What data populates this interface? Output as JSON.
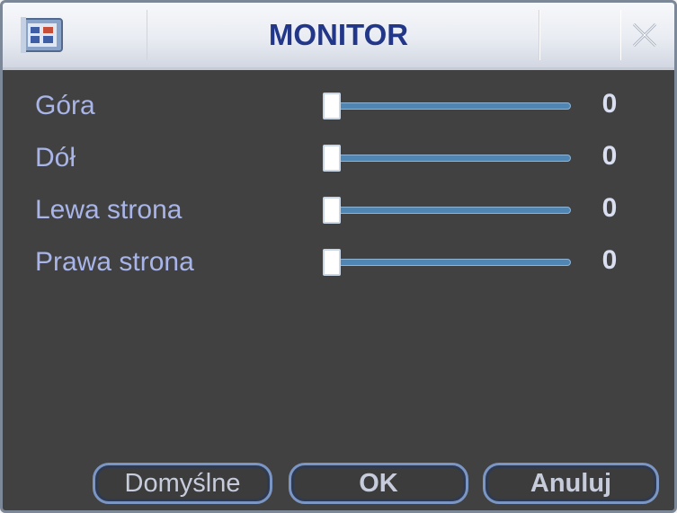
{
  "window": {
    "title": "MONITOR"
  },
  "settings": [
    {
      "label": "Góra",
      "value": "0",
      "fraction": 0
    },
    {
      "label": "Dół",
      "value": "0",
      "fraction": 0
    },
    {
      "label": "Lewa strona",
      "value": "0",
      "fraction": 0
    },
    {
      "label": "Prawa strona",
      "value": "0",
      "fraction": 0
    }
  ],
  "buttons": {
    "default_label": "Domyślne",
    "ok_label": "OK",
    "cancel_label": "Anuluj"
  },
  "colors": {
    "dialog_background": "#414141",
    "title_text": "#223788",
    "label_text": "#a9b5e8",
    "slider_track": "#4f86b4"
  },
  "icons": {
    "app": "monitor-app-icon",
    "close": "close-icon"
  }
}
